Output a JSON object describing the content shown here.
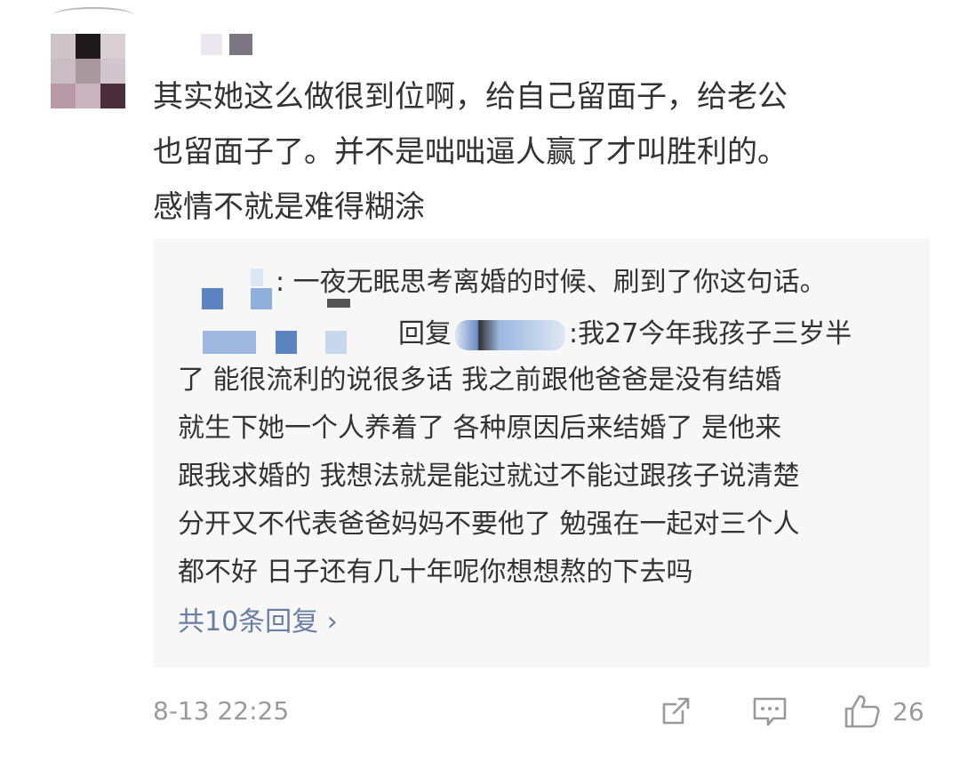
{
  "comment": {
    "lines": [
      "其实她这么做很到位啊，给自己留面子，给老公",
      "也留面子了。并不是咄咄逼人赢了才叫胜利的。",
      "感情不就是难得糊涂"
    ]
  },
  "reply": {
    "first_text": "一夜无眠思考离婚的时候、刷到了你这句话。",
    "second_prefix": "回复",
    "second_lines": [
      "我27今年我孩子三岁半",
      "了 能很流利的说很多话 我之前跟他爸爸是没有结婚",
      "就生下她一个人养着了 各种原因后来结婚了 是他来",
      "跟我求婚的 我想法就是能过就过不能过跟孩子说清楚",
      "分开又不代表爸爸妈妈不要他了 勉强在一起对三个人",
      "都不好 日子还有几十年呢你想想熬的下去吗"
    ],
    "more_label": "共10条回复 ›"
  },
  "footer": {
    "timestamp": "8-13 22:25",
    "like_count": "26"
  },
  "colors": {
    "link": "#6a7ea3",
    "reply_bg": "#f7f7f7",
    "meta": "#9a9a9a",
    "text": "#333333"
  },
  "icons": [
    "share-icon",
    "comment-icon",
    "thumbs-up-icon"
  ]
}
